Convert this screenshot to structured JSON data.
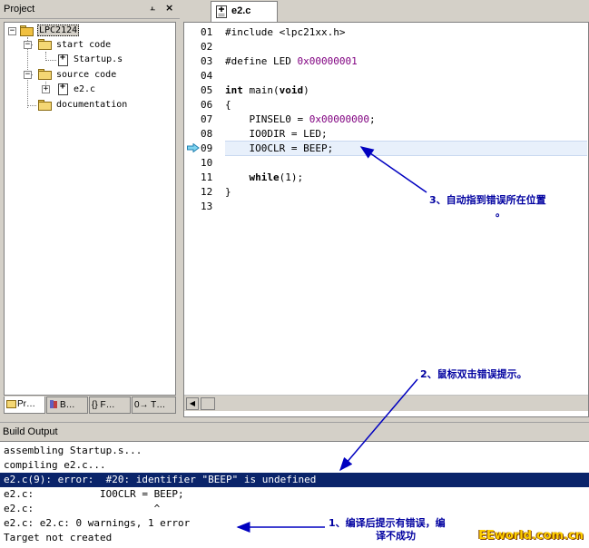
{
  "project": {
    "title": "Project",
    "tree": {
      "root": "LPC2124",
      "groups": [
        {
          "name": "start code",
          "files": [
            "Startup.s"
          ]
        },
        {
          "name": "source code",
          "files": [
            "e2.c"
          ]
        },
        {
          "name": "documentation",
          "files": []
        }
      ]
    },
    "tabs": [
      "Pr…",
      "B…",
      "{} F…",
      "0→ T…"
    ]
  },
  "editor": {
    "active_tab": "e2.c",
    "current_line": 9,
    "line_numbers": [
      "01",
      "02",
      "03",
      "04",
      "05",
      "06",
      "07",
      "08",
      "09",
      "10",
      "11",
      "12",
      "13"
    ],
    "code": {
      "l1": "#include <lpc21xx.h>",
      "l3a": "#define LED ",
      "l3b": "0x00000001",
      "l5a": "int",
      "l5b": " main(",
      "l5c": "void",
      "l5d": ")",
      "l6": "{",
      "l7a": "    PINSEL0 = ",
      "l7b": "0x00000000",
      "l7c": ";",
      "l8": "    IO0DIR = LED;",
      "l9": "    IO0CLR = BEEP;",
      "l11a": "    ",
      "l11b": "while",
      "l11c": "(1);",
      "l12": "}"
    }
  },
  "build": {
    "title": "Build Output",
    "lines": [
      "assembling Startup.s...",
      "compiling e2.c...",
      "e2.c(9): error:  #20: identifier \"BEEP\" is undefined",
      "e2.c:           IO0CLR = BEEP;",
      "e2.c:                    ^",
      "e2.c: e2.c: 0 warnings, 1 error",
      "Target not created"
    ],
    "selected_line": 2
  },
  "annotations": {
    "a3_line1": "3、自动指到错误所在位置",
    "a3_line2": "。",
    "a2": "2、鼠标双击错误提示。",
    "a1_line1": "1、编译后提示有错误，编",
    "a1_line2": "译不成功",
    "arrow_color": "#0000c0"
  },
  "watermark": "EEworld.com.cn",
  "colors": {
    "selection": "#0a246a",
    "hex_literal": "#800080",
    "current_line_bg": "#e8f0fb",
    "panel": "#d4d0c8"
  }
}
